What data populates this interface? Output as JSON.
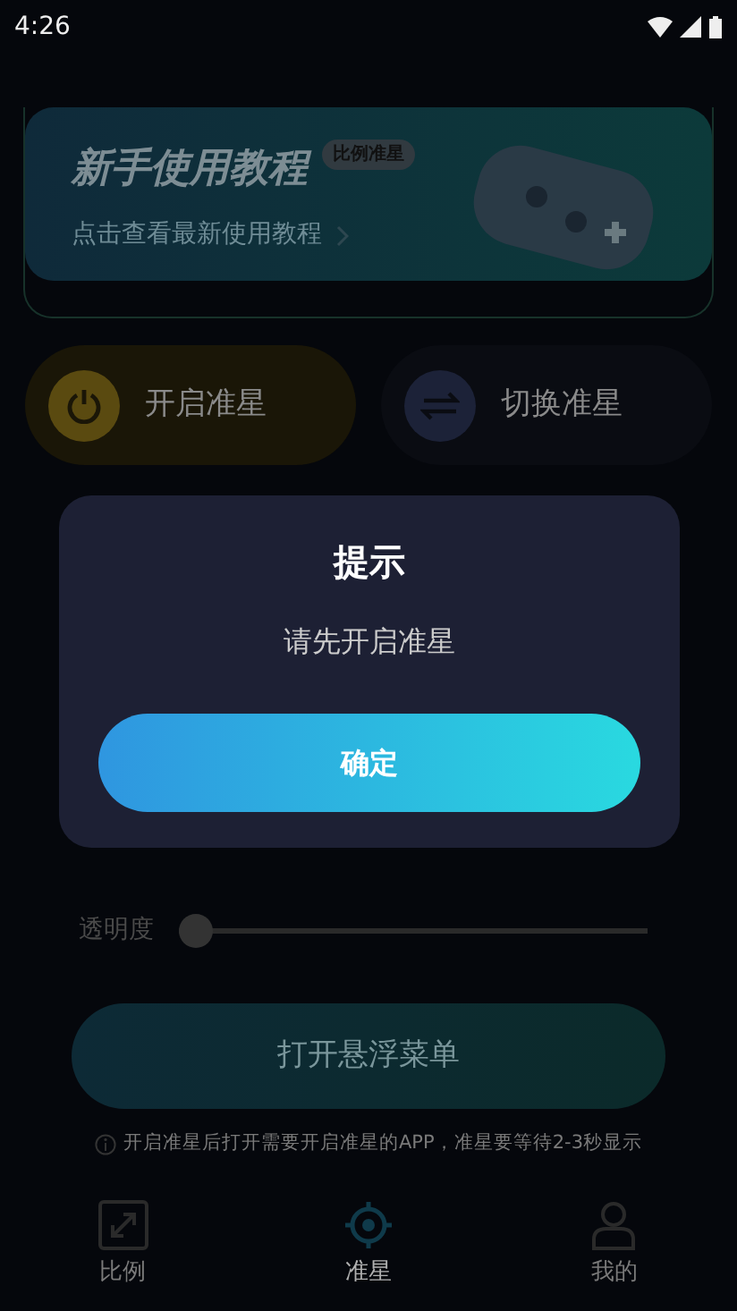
{
  "status_bar": {
    "time": "4:26"
  },
  "banner": {
    "title": "新手使用教程",
    "tag": "比例准星",
    "subtitle": "点击查看最新使用教程"
  },
  "actions": [
    {
      "label": "开启准星",
      "kind": "power"
    },
    {
      "label": "切换准星",
      "kind": "switch"
    }
  ],
  "opacity": {
    "label": "透明度",
    "level": 0
  },
  "float_button": {
    "label": "打开悬浮菜单"
  },
  "notice": "开启准星后打开需要开启准星的APP，准星要等待2-3秒显示",
  "nav": [
    {
      "label": "比例",
      "selected": false,
      "kind": "ratio"
    },
    {
      "label": "准星",
      "selected": true,
      "kind": "crosshair"
    },
    {
      "label": "我的",
      "selected": false,
      "kind": "profile"
    }
  ],
  "dialog": {
    "title": "提示",
    "message": "请先开启准星",
    "button": "确定"
  }
}
